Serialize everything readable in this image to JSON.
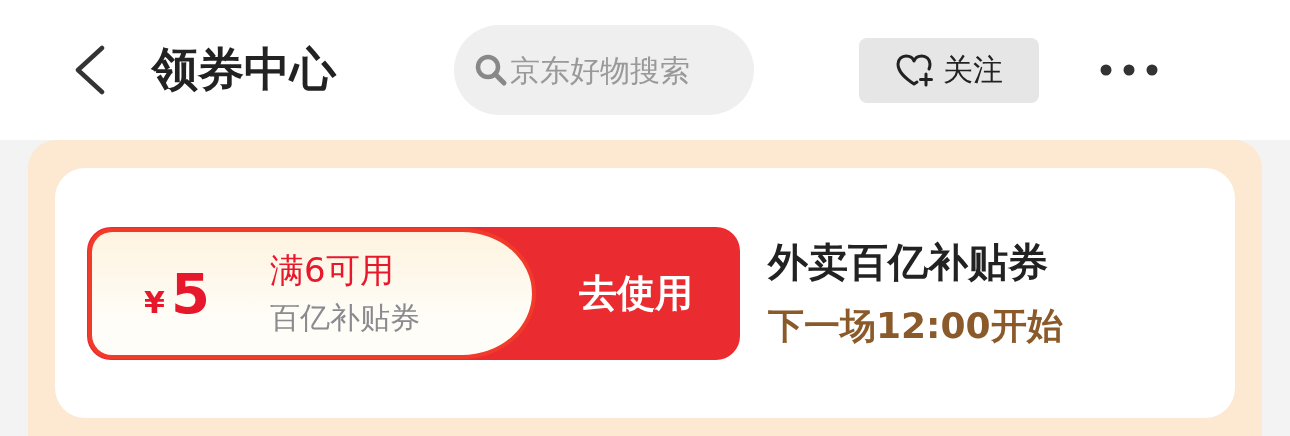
{
  "header": {
    "title": "领券中心",
    "search": {
      "placeholder": "京东好物搜索"
    },
    "follow_button": {
      "label": "关注"
    }
  },
  "coupon": {
    "currency": "¥",
    "amount": "5",
    "condition": "满6可用",
    "type": "百亿补贴券",
    "action": "去使用",
    "name": "外卖百亿补贴券",
    "next_session": "下一场12:00开始"
  }
}
